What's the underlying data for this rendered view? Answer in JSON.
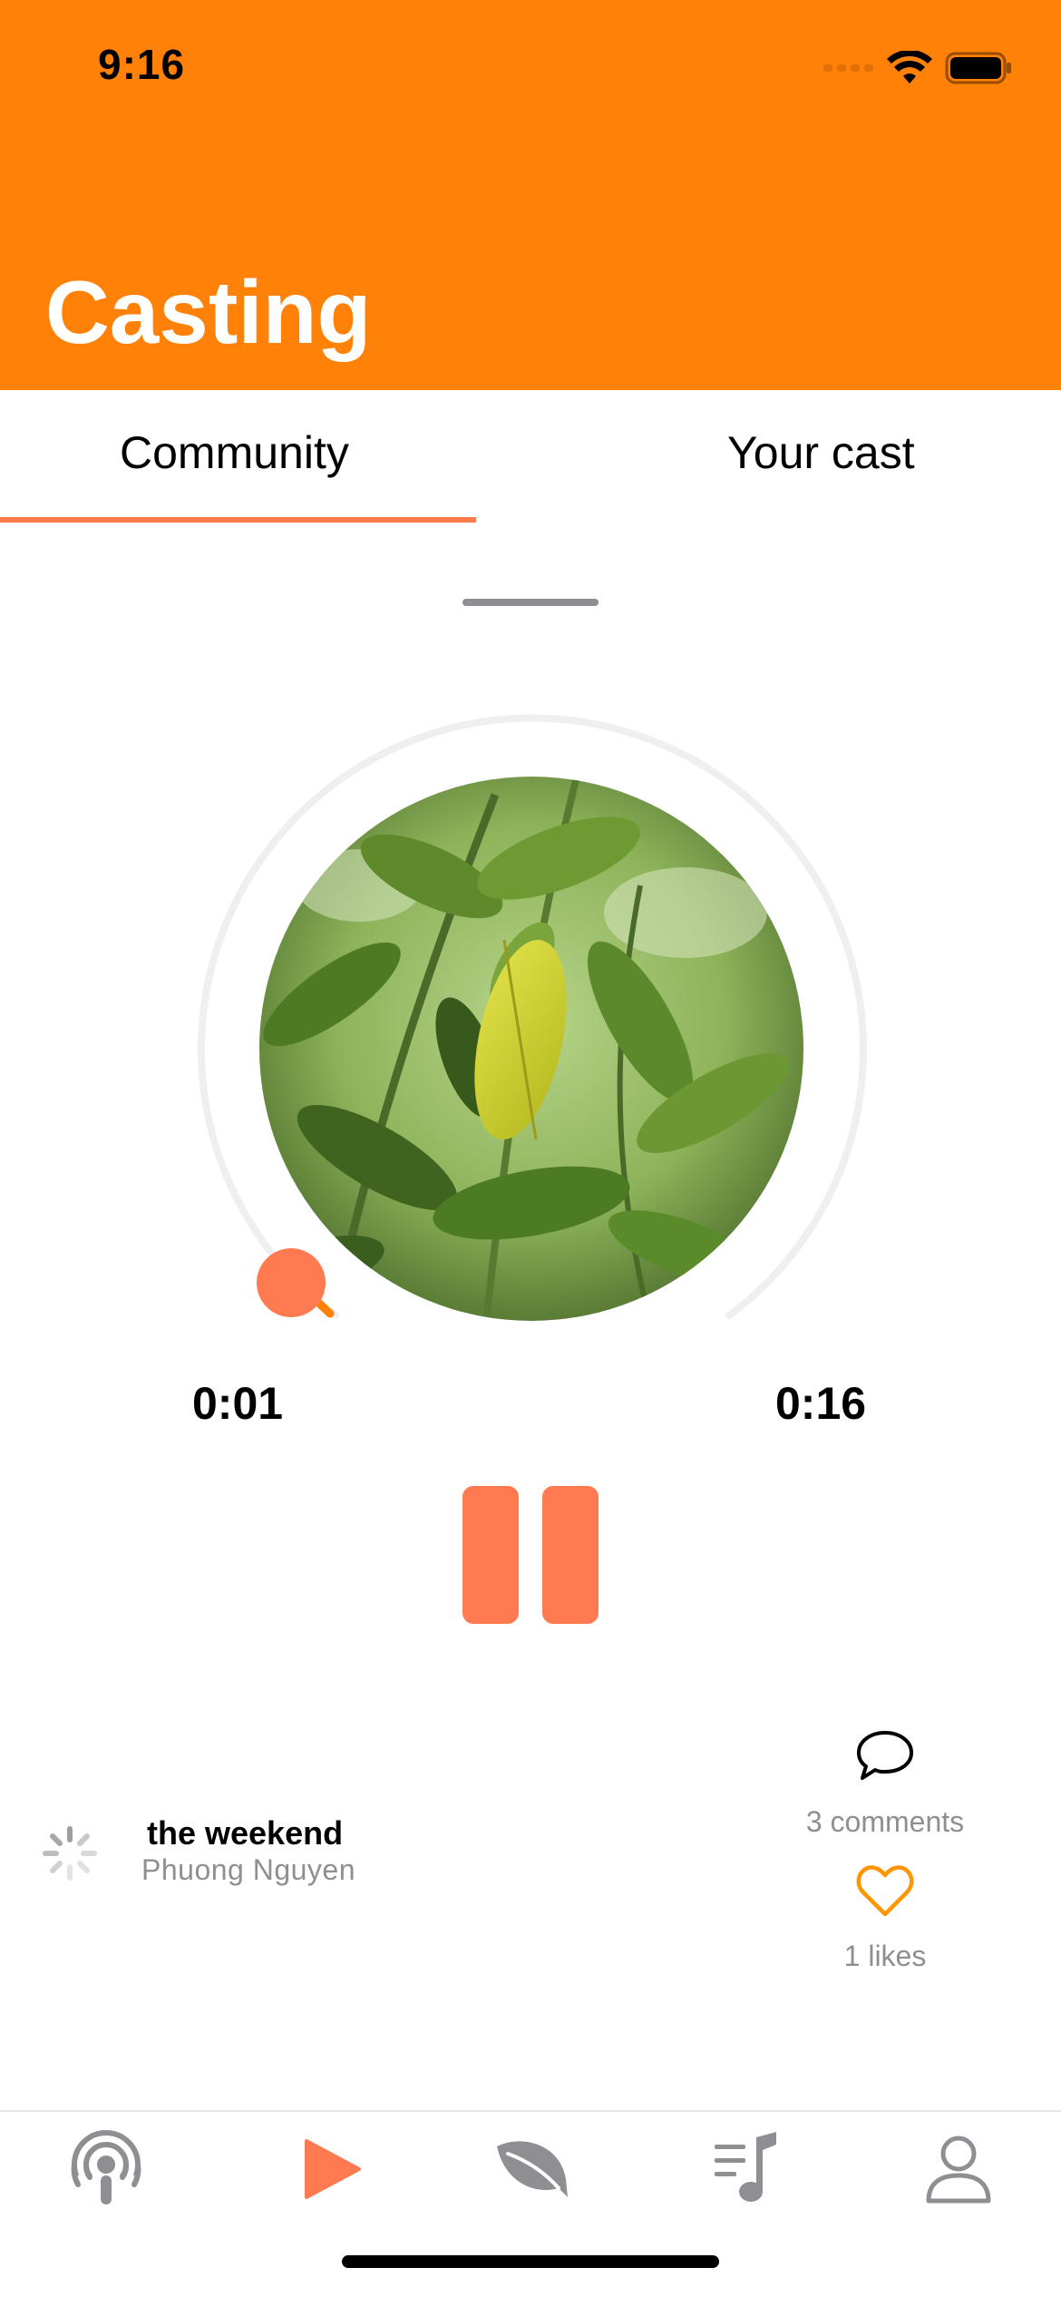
{
  "status_bar": {
    "time": "9:16"
  },
  "header": {
    "title": "Casting"
  },
  "tabs": [
    {
      "label": "Community",
      "selected": true
    },
    {
      "label": "Your cast",
      "selected": false
    }
  ],
  "player": {
    "elapsed": "0:01",
    "duration": "0:16",
    "progress_fraction": 0.0625,
    "artwork": "plant-leaves-photo",
    "state": "playing"
  },
  "track": {
    "title": "the weekend",
    "artist": "Phuong Nguyen"
  },
  "engagement": {
    "comments_label": "3 comments",
    "likes_label": "1 likes"
  },
  "tab_bar": [
    {
      "name": "podcast-icon",
      "active": false
    },
    {
      "name": "play-icon",
      "active": true
    },
    {
      "name": "leaf-icon",
      "active": false
    },
    {
      "name": "playlist-icon",
      "active": false
    },
    {
      "name": "profile-icon",
      "active": false
    }
  ],
  "colors": {
    "header": "#ff8107",
    "accent": "#ff7a50",
    "heart": "#ff9500",
    "inactive_icon": "#8e8e93"
  }
}
